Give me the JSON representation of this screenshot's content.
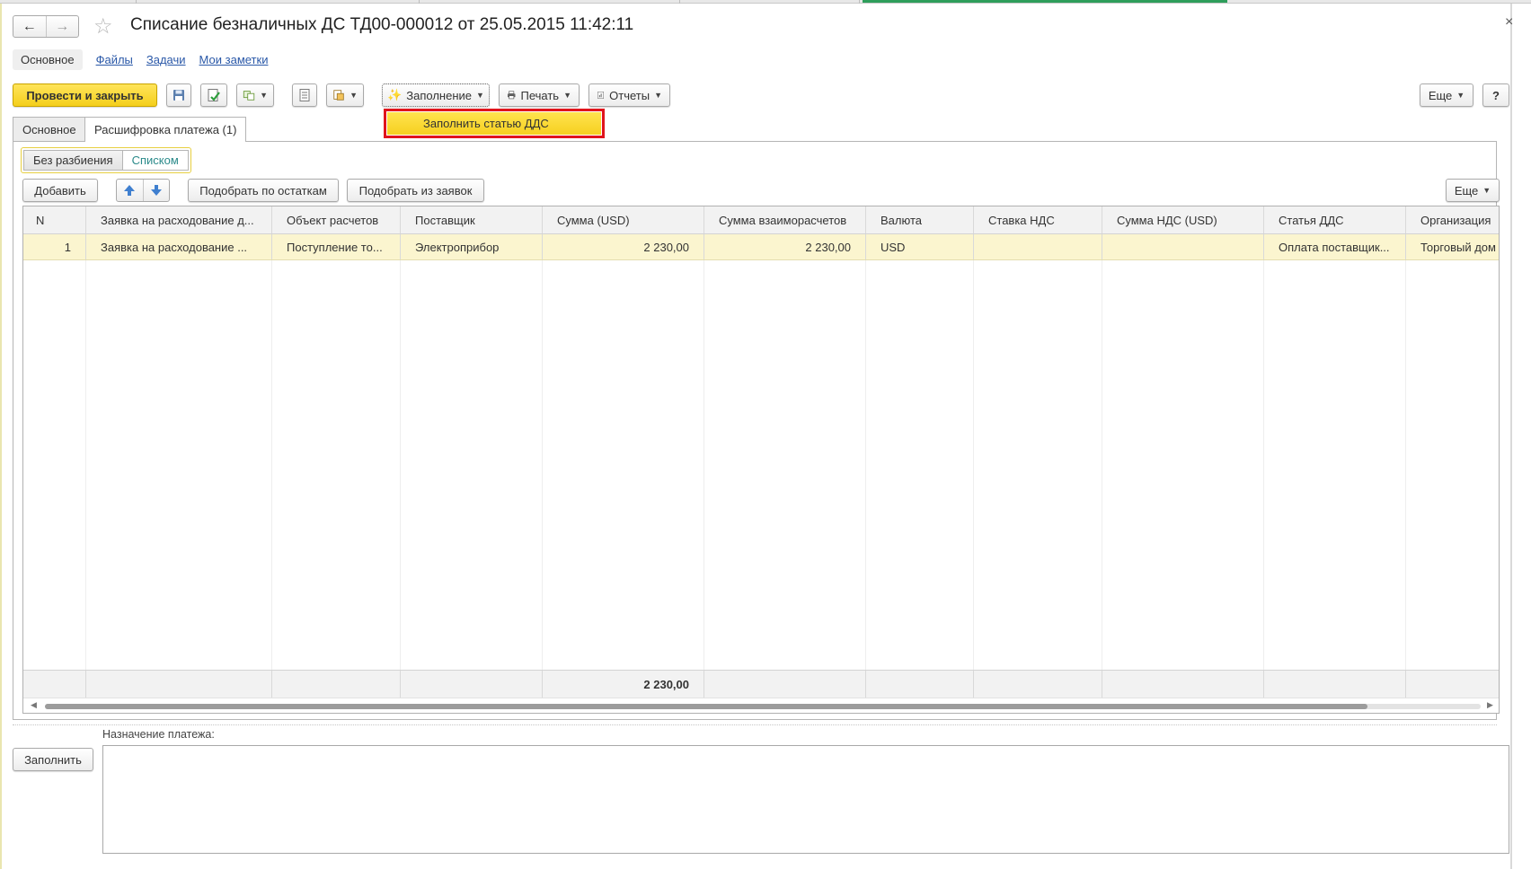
{
  "window": {
    "title": "Списание безналичных ДС ТД00-000012 от 25.05.2015 11:42:11",
    "close_glyph": "×"
  },
  "nav": {
    "back_icon": "arrow-left-icon",
    "forward_icon": "arrow-right-icon",
    "star_icon": "star-icon"
  },
  "section_nav": {
    "items": [
      "Основное",
      "Файлы",
      "Задачи",
      "Мои заметки"
    ]
  },
  "toolbar": {
    "post_close_label": "Провести и закрыть",
    "fill_label": "Заполнение",
    "print_label": "Печать",
    "reports_label": "Отчеты",
    "more_label": "Еще",
    "help_label": "?"
  },
  "fill_menu": {
    "items": [
      "Заполнить статью ДДС"
    ]
  },
  "tabs": [
    {
      "label": "Основное",
      "active": false
    },
    {
      "label": "Расшифровка платежа (1)",
      "active": true
    }
  ],
  "split_toggle": {
    "options": [
      "Без разбиения",
      "Списком"
    ],
    "selected": "Списком"
  },
  "table_toolbar": {
    "add_label": "Добавить",
    "pick_balance_label": "Подобрать по остаткам",
    "pick_requests_label": "Подобрать из заявок",
    "more_label": "Еще"
  },
  "table": {
    "columns": [
      "N",
      "Заявка на расходование д...",
      "Объект расчетов",
      "Поставщик",
      "Сумма (USD)",
      "Сумма взаиморасчетов",
      "Валюта",
      "Ставка НДС",
      "Сумма НДС (USD)",
      "Статья ДДС",
      "Организация"
    ],
    "rows": [
      [
        "1",
        "Заявка на расходование ...",
        "Поступление то...",
        "Электроприбор",
        "2 230,00",
        "2 230,00",
        "USD",
        "",
        "",
        "Оплата поставщик...",
        "Торговый дом"
      ]
    ],
    "totals": {
      "amount_usd": "2 230,00"
    }
  },
  "bottom": {
    "fill_button_label": "Заполнить",
    "purpose_label": "Назначение платежа:",
    "purpose_value": ""
  },
  "colors": {
    "accent_yellow": "#f6d01f",
    "selected_row": "#fbf5cf",
    "highlight_red": "#e0141c",
    "link_blue": "#2a58a8"
  }
}
